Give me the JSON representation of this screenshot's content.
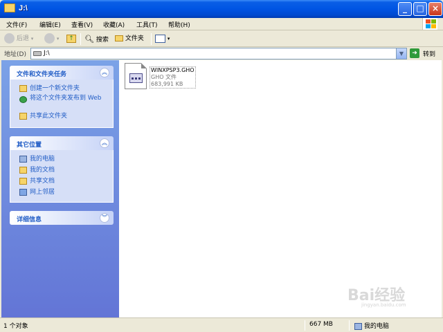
{
  "window": {
    "title": "J:\\"
  },
  "title_buttons": {
    "minimize": "_",
    "maximize": "□",
    "close": "×"
  },
  "menu": [
    "文件(F)",
    "编辑(E)",
    "查看(V)",
    "收藏(A)",
    "工具(T)",
    "帮助(H)"
  ],
  "toolbar": {
    "back": "后退",
    "search": "搜索",
    "folders": "文件夹"
  },
  "address": {
    "label": "地址(D)",
    "value": "J:\\",
    "go": "转到"
  },
  "left_panel": {
    "tasks": {
      "title": "文件和文件夹任务",
      "items": [
        "创建一个新文件夹",
        "将这个文件夹发布到 Web",
        "共享此文件夹"
      ]
    },
    "places": {
      "title": "其它位置",
      "items": [
        "我的电脑",
        "我的文档",
        "共享文档",
        "网上邻居"
      ]
    },
    "details": {
      "title": "详细信息"
    }
  },
  "file": {
    "name": "WINXPSP3.GHO",
    "type": "GHO 文件",
    "size": "683,991 KB"
  },
  "status": {
    "count": "1 个对象",
    "size": "667 MB",
    "location": "我的电脑"
  },
  "watermark": {
    "text": "Bai经验",
    "sub": "jingyan.baidu.com"
  },
  "colors": {
    "title_bar": "#0054e3",
    "left_panel": "#7ba2e7",
    "link": "#215dc6"
  }
}
